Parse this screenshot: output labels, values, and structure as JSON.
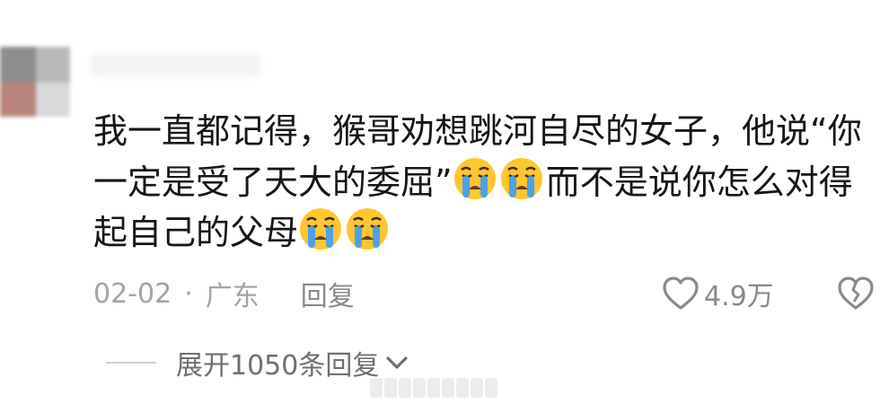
{
  "comment": {
    "line1": "我一直都记得，猴哥劝想跳河自尽的女子，他说“你",
    "line2_before": "一定是受了天大的委屈”",
    "line2_after": "而不是说你怎么对得",
    "line3": "起自己的父母",
    "emoji_name": "loudly-crying-face-icon"
  },
  "meta": {
    "date": "02-02",
    "separator": "·",
    "location": "广东",
    "reply_label": "回复"
  },
  "like": {
    "count": "4.9万"
  },
  "replies": {
    "expand_label": "展开1050条回复"
  },
  "colors": {
    "text": "#161616",
    "meta": "#a3a3a3",
    "emoji_face": "#ffc62d",
    "emoji_tear": "#4aa3e8"
  }
}
